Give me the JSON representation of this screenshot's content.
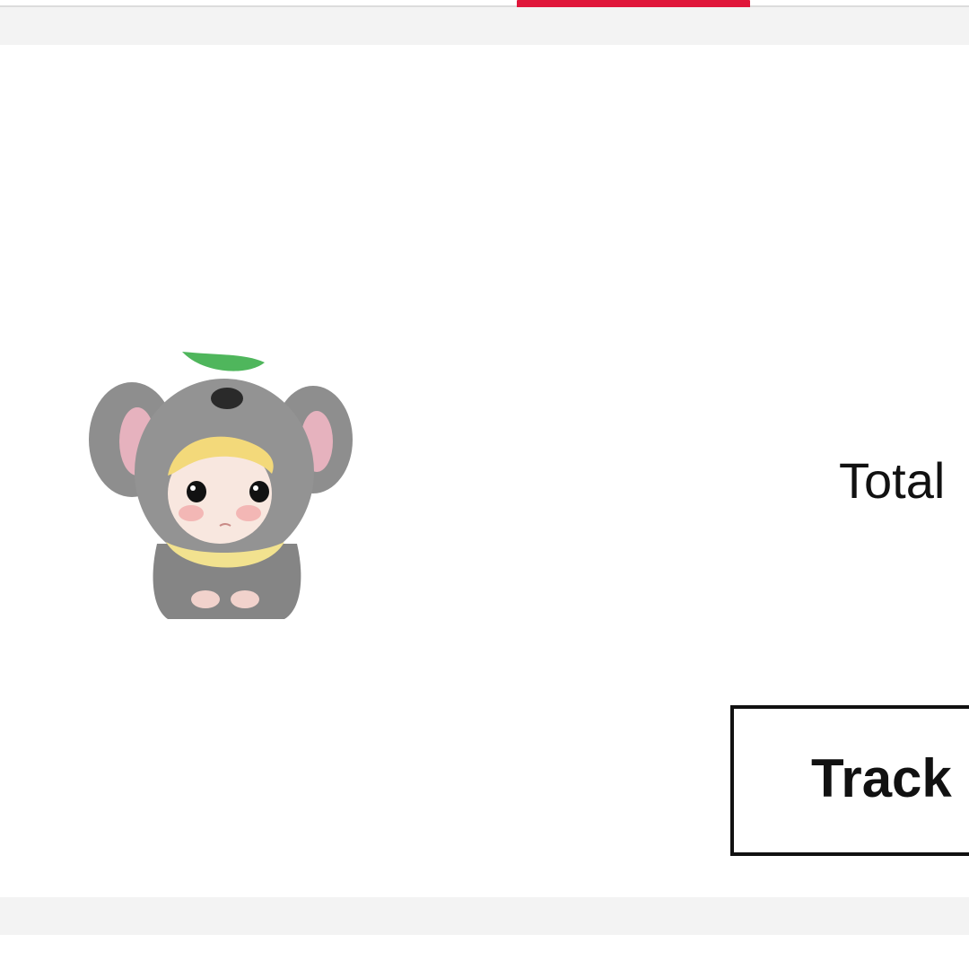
{
  "tabs": {
    "active_indicator_color": "#e0163a"
  },
  "order": {
    "product": {
      "image_icon": "koala-costume-figure",
      "colors": {
        "fur": "#8d8d8d",
        "ear_inner": "#e7b3bf",
        "leaf": "#4fb65c",
        "hair": "#f4dc79",
        "collar": "#f2e38f"
      }
    },
    "total_label": "Total",
    "track_button_label": "Track"
  }
}
